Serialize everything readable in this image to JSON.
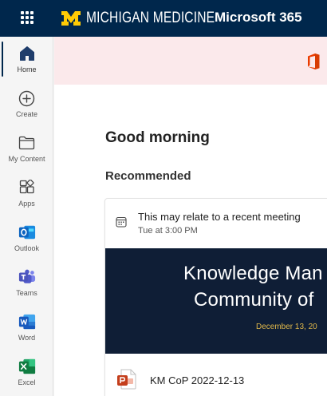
{
  "header": {
    "brand_text": "MICHIGAN MEDICINE",
    "brand_logo": "block-m-logo",
    "suite_title": "Microsoft 365",
    "waffle_icon": "app-launcher-icon"
  },
  "sidebar": {
    "items": [
      {
        "label": "Home",
        "icon": "home-icon",
        "active": true
      },
      {
        "label": "Create",
        "icon": "plus-circle-icon"
      },
      {
        "label": "My Content",
        "icon": "folder-icon"
      },
      {
        "label": "Apps",
        "icon": "apps-icon"
      },
      {
        "label": "Outlook",
        "icon": "outlook-icon"
      },
      {
        "label": "Teams",
        "icon": "teams-icon"
      },
      {
        "label": "Word",
        "icon": "word-icon"
      },
      {
        "label": "Excel",
        "icon": "excel-icon"
      }
    ]
  },
  "main": {
    "greeting": "Good morning",
    "recommended_heading": "Recommended",
    "card": {
      "reason": "This may relate to a recent meeting",
      "time": "Tue at 3:00 PM",
      "thumbnail_line1": "Knowledge Man",
      "thumbnail_line2": "Community of",
      "thumbnail_date": "December 13, 20",
      "file_name": "KM CoP 2022-12-13",
      "file_icon": "powerpoint-icon"
    }
  },
  "colors": {
    "topbar": "#00274c",
    "maize": "#ffcb05",
    "banner": "#fbe9eb",
    "thumbnail_bg": "#0f1e36",
    "thumbnail_date": "#e0b84a"
  }
}
